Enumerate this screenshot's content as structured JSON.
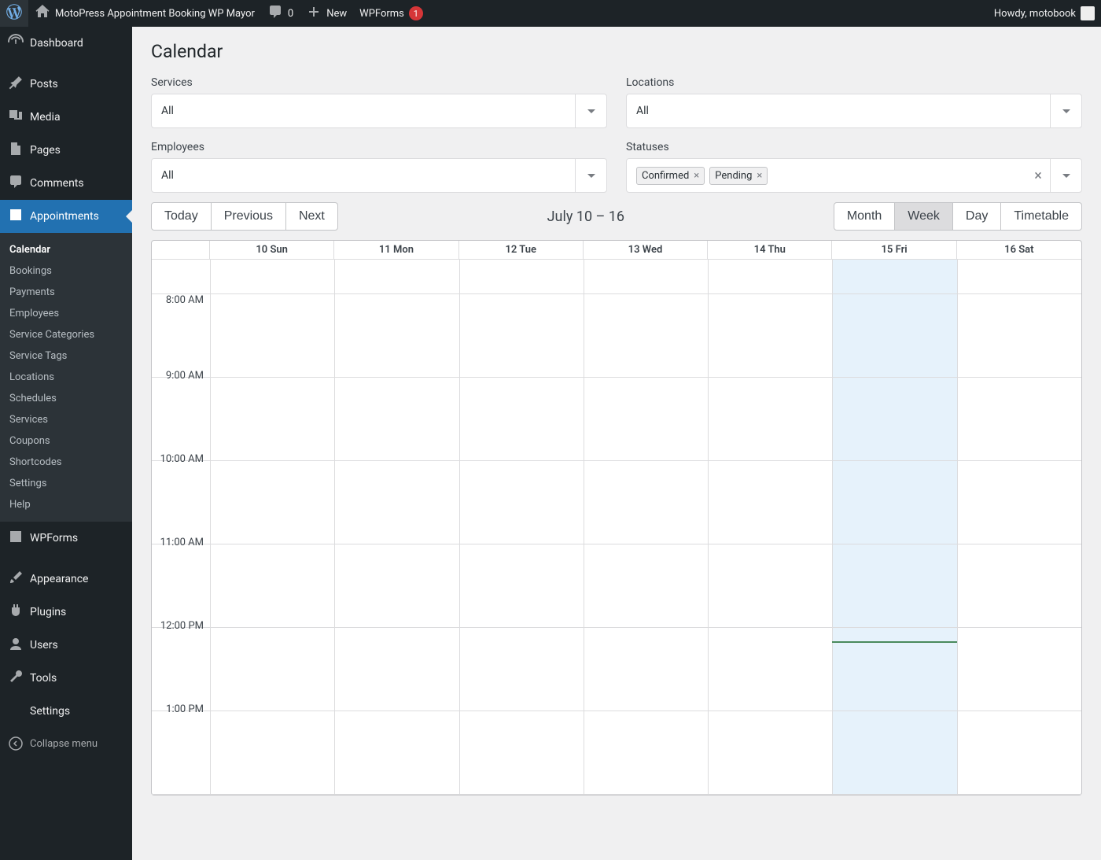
{
  "adminbar": {
    "site_title": "MotoPress Appointment Booking WP Mayor",
    "comments_count": "0",
    "new_label": "New",
    "wpforms_label": "WPForms",
    "wpforms_badge": "1",
    "howdy": "Howdy, motobook"
  },
  "menu": {
    "dashboard": "Dashboard",
    "posts": "Posts",
    "media": "Media",
    "pages": "Pages",
    "comments": "Comments",
    "appointments": "Appointments",
    "wpforms": "WPForms",
    "appearance": "Appearance",
    "plugins": "Plugins",
    "users": "Users",
    "tools": "Tools",
    "settings": "Settings",
    "collapse": "Collapse menu"
  },
  "submenu": {
    "calendar": "Calendar",
    "bookings": "Bookings",
    "payments": "Payments",
    "employees": "Employees",
    "service_categories": "Service Categories",
    "service_tags": "Service Tags",
    "locations": "Locations",
    "schedules": "Schedules",
    "services": "Services",
    "coupons": "Coupons",
    "shortcodes": "Shortcodes",
    "settings": "Settings",
    "help": "Help"
  },
  "page": {
    "title": "Calendar"
  },
  "filters": {
    "services_label": "Services",
    "services_value": "All",
    "locations_label": "Locations",
    "locations_value": "All",
    "employees_label": "Employees",
    "employees_value": "All",
    "statuses_label": "Statuses",
    "statuses_tags": [
      "Confirmed",
      "Pending"
    ]
  },
  "toolbar": {
    "today": "Today",
    "previous": "Previous",
    "next": "Next",
    "range": "July 10 – 16",
    "views": {
      "month": "Month",
      "week": "Week",
      "day": "Day",
      "timetable": "Timetable"
    },
    "active_view": "week"
  },
  "calendar": {
    "days": [
      "10 Sun",
      "11 Mon",
      "12 Tue",
      "13 Wed",
      "14 Thu",
      "15 Fri",
      "16 Sat"
    ],
    "today_index": 5,
    "times": [
      "8:00 AM",
      "9:00 AM",
      "10:00 AM",
      "11:00 AM",
      "12:00 PM",
      "1:00 PM"
    ]
  }
}
